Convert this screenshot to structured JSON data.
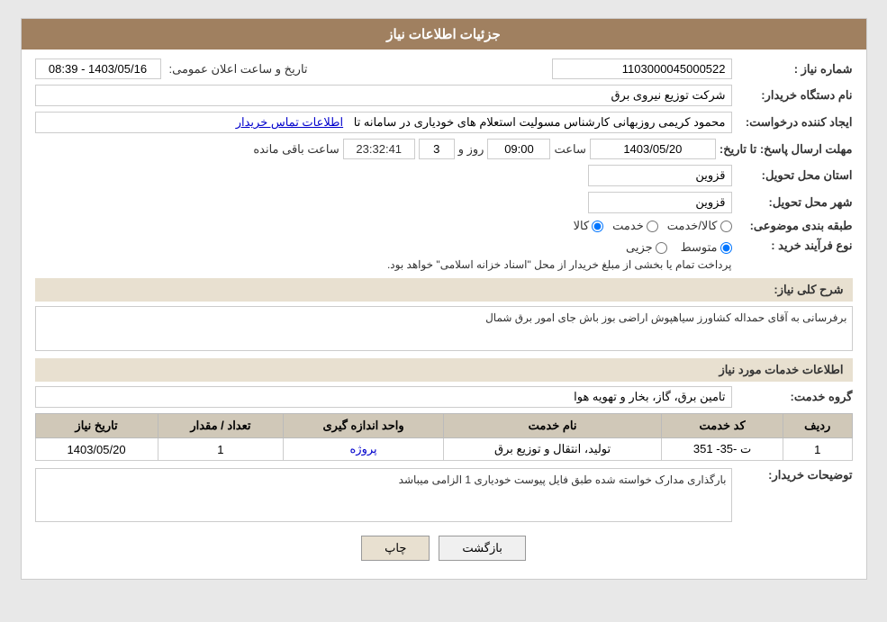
{
  "header": {
    "title": "جزئیات اطلاعات نیاز"
  },
  "form": {
    "need_number_label": "شماره نیاز :",
    "need_number_value": "1103000045000522",
    "buyer_org_label": "نام دستگاه خریدار:",
    "buyer_org_value": "شرکت توزیع نیروی برق",
    "creator_label": "ایجاد کننده درخواست:",
    "creator_value": "محمود کریمی روزبهانی کارشناس  مسولیت استعلام های خودیاری در سامانه تا",
    "creator_link": "اطلاعات تماس خریدار",
    "response_deadline_label": "مهلت ارسال پاسخ: تا تاریخ:",
    "response_date": "1403/05/20",
    "response_time_label": "ساعت",
    "response_time": "09:00",
    "response_days_label": "روز و",
    "response_days": "3",
    "countdown_label": "ساعت باقی مانده",
    "countdown_value": "23:32:41",
    "delivery_province_label": "استان محل تحویل:",
    "delivery_province_value": "قزوین",
    "delivery_city_label": "شهر محل تحویل:",
    "delivery_city_value": "قزوین",
    "category_label": "طبقه بندی موضوعی:",
    "category_options": [
      "کالا",
      "خدمت",
      "کالا/خدمت"
    ],
    "category_selected": "کالا",
    "purchase_type_label": "نوع فرآیند خرید :",
    "purchase_options": [
      "جزیی",
      "متوسط"
    ],
    "purchase_selected": "متوسط",
    "purchase_desc": "پرداخت تمام یا بخشی از مبلغ خریدار از محل \"اسناد خزانه اسلامی\" خواهد بود.",
    "announcement_label": "تاریخ و ساعت اعلان عمومی:",
    "announcement_value": "1403/05/16 - 08:39",
    "need_description_label": "شرح کلی نیاز:",
    "need_description_value": "برفرسانی به آقای حمداله کشاورز سیاهپوش اراضی بوز باش جای امور برق شمال",
    "services_section_label": "اطلاعات خدمات مورد نیاز",
    "service_group_label": "گروه خدمت:",
    "service_group_value": "تامین برق، گاز، بخار و تهویه هوا",
    "table": {
      "headers": [
        "ردیف",
        "کد خدمت",
        "نام خدمت",
        "واحد اندازه گیری",
        "تعداد / مقدار",
        "تاریخ نیاز"
      ],
      "rows": [
        {
          "row_num": "1",
          "service_code": "ت -35- 351",
          "service_name": "تولید، انتقال و توزیع برق",
          "unit": "پروژه",
          "quantity": "1",
          "date": "1403/05/20"
        }
      ]
    },
    "buyer_notes_label": "توضیحات خریدار:",
    "buyer_notes_value": "بارگذاری مدارک خواسته شده طبق فایل پیوست خودیاری 1 الزامی میباشد",
    "btn_print": "چاپ",
    "btn_back": "بازگشت"
  }
}
